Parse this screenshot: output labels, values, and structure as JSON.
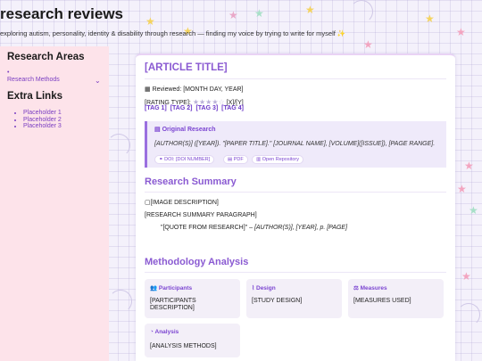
{
  "site": {
    "title": "research reviews",
    "tagline": "exploring autism, personality, identity & disability through research — finding my voice by trying to write for myself ✨"
  },
  "sidebar": {
    "research_areas_heading": "Research Areas",
    "research_methods_label": "Research Methods",
    "extra_links_heading": "Extra Links",
    "links": [
      "Placeholder 1",
      "Placeholder 2",
      "Placeholder 3"
    ]
  },
  "article": {
    "title": "[ARTICLE TITLE]",
    "reviewed": "Reviewed: [MONTH DAY, YEAR]",
    "rating_label": "[RATING TYPE]:",
    "rating_value": 4,
    "rating_max": 5,
    "rating_suffix": "[X]/[Y]",
    "tags": [
      "[TAG 1]",
      "[TAG 2]",
      "[TAG 3]",
      "[TAG 4]"
    ],
    "original_research": {
      "heading": "Original Research",
      "citation": "[AUTHOR(S)] ([YEAR]). \"[PAPER TITLE].\" [JOURNAL NAME], [VOLUME]([ISSUE]), [PAGE RANGE].",
      "doi": "DOI: [DOI NUMBER]",
      "pdf": "PDF",
      "repository": "Open Repository"
    },
    "summary": {
      "heading": "Research Summary",
      "image_alt": "[IMAGE DESCRIPTION]",
      "paragraph": "[RESEARCH SUMMARY PARAGRAPH]",
      "quote_text": "\"[QUOTE FROM RESEARCH]\" – ",
      "quote_source": "[AUTHOR(S)], [YEAR], p. [PAGE]"
    },
    "methodology": {
      "heading": "Methodology Analysis",
      "participants_label": "Participants",
      "participants_value": "[PARTICIPANTS DESCRIPTION]",
      "design_label": "Design",
      "design_value": "[STUDY DESIGN]",
      "measures_label": "Measures",
      "measures_value": "[MEASURES USED]",
      "analysis_label": "Analysis",
      "analysis_value": "[ANALYSIS METHODS]"
    }
  },
  "colors": {
    "accent": "#8a5ad2",
    "link": "#7b3fc2",
    "sidebar_bg": "#fde3ea",
    "card_bg": "#f3eff8"
  }
}
